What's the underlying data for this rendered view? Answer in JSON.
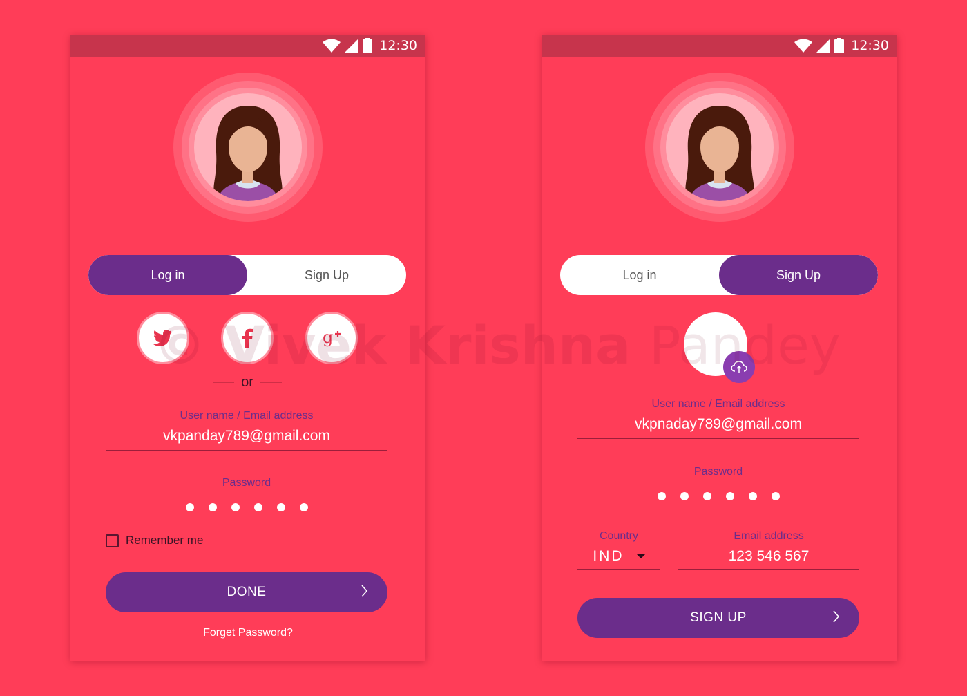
{
  "status_bar": {
    "time": "12:30"
  },
  "login": {
    "tabs": {
      "login": "Log in",
      "signup": "Sign Up"
    },
    "divider": "or",
    "username": {
      "label": "User name / Email address",
      "value": "vkpanday789@gmail.com"
    },
    "password": {
      "label": "Password",
      "dot_count": 6
    },
    "remember": "Remember me",
    "done_button": "DONE",
    "forgot": "Forget Password?",
    "social": [
      "twitter-icon",
      "facebook-icon",
      "google-plus-icon"
    ]
  },
  "signup": {
    "tabs": {
      "login": "Log in",
      "signup": "Sign Up"
    },
    "username": {
      "label": "User name / Email address",
      "value": "vkpnaday789@gmail.com"
    },
    "password": {
      "label": "Password",
      "dot_count": 6
    },
    "country": {
      "label": "Country",
      "value": "IND"
    },
    "email": {
      "label": "Email address",
      "value": "123 546 567"
    },
    "signup_button": "SIGN UP"
  },
  "watermark": {
    "bold": "© Vivek Krishna ",
    "light": "Pandey"
  },
  "colors": {
    "background": "#ff3d58",
    "accent": "#6b2d8b",
    "status_bar": "#c7344c"
  }
}
